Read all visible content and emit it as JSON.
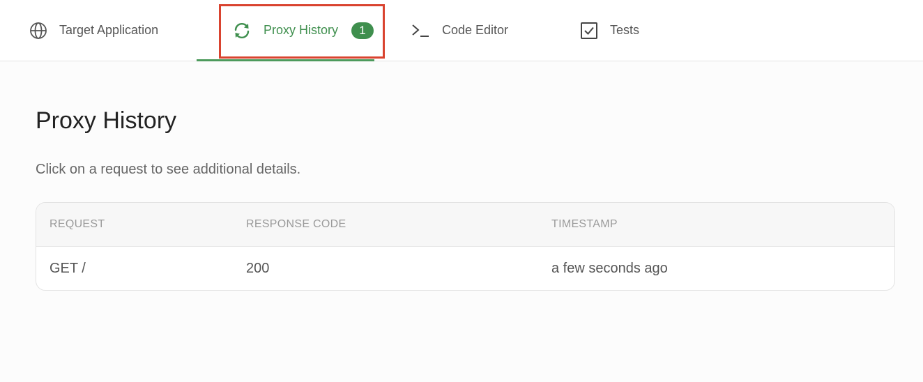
{
  "tabs": {
    "target": {
      "label": "Target Application",
      "icon": "globe-icon"
    },
    "proxy": {
      "label": "Proxy History",
      "icon": "refresh-icon",
      "badge": "1"
    },
    "code": {
      "label": "Code Editor",
      "icon": "terminal-icon"
    },
    "tests": {
      "label": "Tests",
      "icon": "checkbox-icon"
    }
  },
  "colors": {
    "accent": "#3f8f4e",
    "highlight": "#d9432f"
  },
  "main": {
    "title": "Proxy History",
    "subtitle": "Click on a request to see additional details.",
    "table": {
      "headers": [
        "REQUEST",
        "RESPONSE CODE",
        "TIMESTAMP"
      ],
      "rows": [
        [
          "GET /",
          "200",
          "a few seconds ago"
        ]
      ]
    }
  }
}
